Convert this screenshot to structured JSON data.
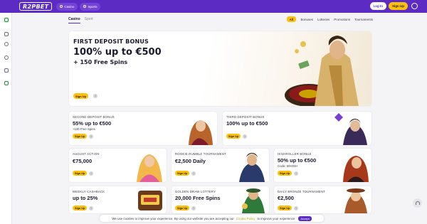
{
  "header": {
    "logo_text": "R2PBET",
    "nav": [
      {
        "label": "Casino",
        "icon": "casino-icon"
      },
      {
        "label": "Sports",
        "icon": "sports-icon"
      }
    ],
    "login_label": "Log In",
    "signup_label": "Sign Up"
  },
  "sidebar": {
    "icons": [
      "sports-icon",
      "games-icon",
      "casino-chip-icon",
      "ball-icon",
      "gift-icon",
      "promotion-icon"
    ]
  },
  "tabs": [
    "Casino",
    "Sport"
  ],
  "filters": [
    "All",
    "Bonuses",
    "Lotteries",
    "Promotions",
    "Tournaments"
  ],
  "hero": {
    "eyebrow": "FIRST DEPOSIT BONUS",
    "title": "100% up to €500",
    "subtitle": "+ 150 Free Spins",
    "button": "Sign Up"
  },
  "cards": [
    {
      "eyebrow": "SECOND DEPOSIT BONUS",
      "title": "55% up to €500",
      "subtitle": "+100 Free Spins",
      "button": "Sign Up"
    },
    {
      "eyebrow": "THIRD DEPOSIT BONUS",
      "title": "100% up to €500",
      "subtitle": "",
      "button": "Sign Up"
    },
    {
      "eyebrow": "AUGUST ACTION",
      "title": "€75,000",
      "subtitle": "",
      "button": "Sign Up"
    },
    {
      "eyebrow": "ROOKIE RUMBLE TOURNAMENT",
      "title": "€2,500 Daily",
      "subtitle": "",
      "button": "Sign Up"
    },
    {
      "eyebrow": "HIGHROLLER BONUS",
      "title": "50% up to €500",
      "subtitle": "Code: 50HIGH",
      "button": "Sign Up"
    },
    {
      "eyebrow": "WEEKLY CASHBACK",
      "title": "up to 25%",
      "subtitle": "",
      "button": "Sign Up"
    },
    {
      "eyebrow": "GOLDEN DRAW LOTTERY",
      "title": "20,000 Free Spins",
      "subtitle": "",
      "button": "Sign Up"
    },
    {
      "eyebrow": "DAILY BRONZE TOURNAMENT",
      "title": "€2,500",
      "subtitle": "",
      "button": "Sign Up"
    }
  ],
  "cookie": {
    "text_before": "We use cookies to improve your experience. By using our website you are accepting our",
    "policy": "Cookie Policy",
    "text_after": "to improve your experience",
    "accept": "Accept"
  },
  "colors": {
    "brand": "#5b2bc4",
    "accent": "#ffc107",
    "background": "#f4f4f7"
  }
}
